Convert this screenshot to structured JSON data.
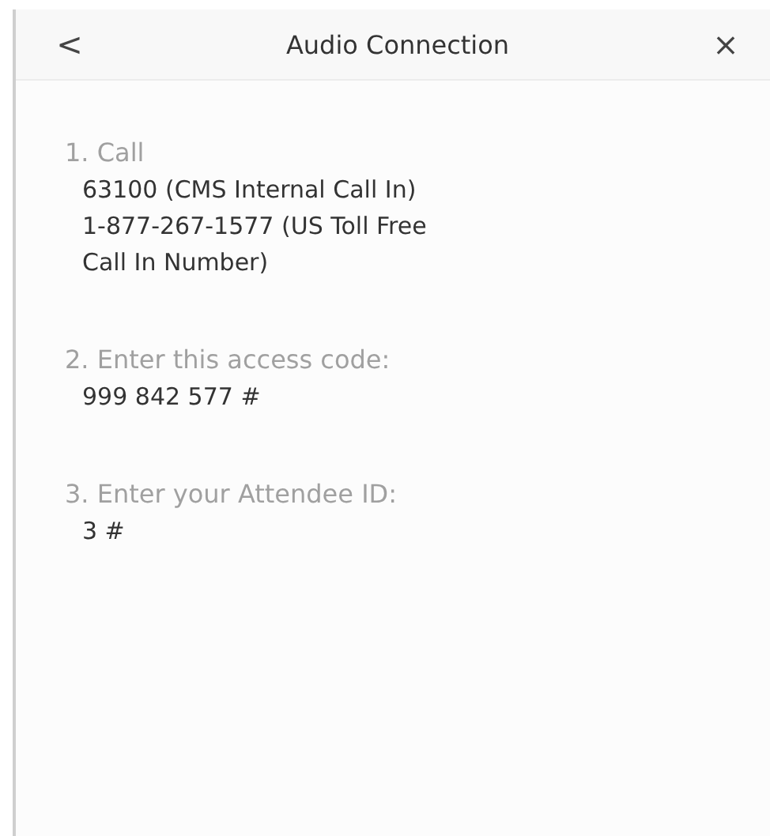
{
  "header": {
    "back": "<",
    "title": "Audio Connection",
    "close": "×"
  },
  "steps": [
    {
      "label": "1. Call",
      "details": [
        "63100 (CMS Internal Call In)",
        "1-877-267-1577 (US Toll Free Call In Number)"
      ]
    },
    {
      "label": "2. Enter this access code:",
      "details": [
        "999 842 577 #"
      ]
    },
    {
      "label": "3. Enter your Attendee ID:",
      "details": [
        "3 #"
      ]
    }
  ]
}
